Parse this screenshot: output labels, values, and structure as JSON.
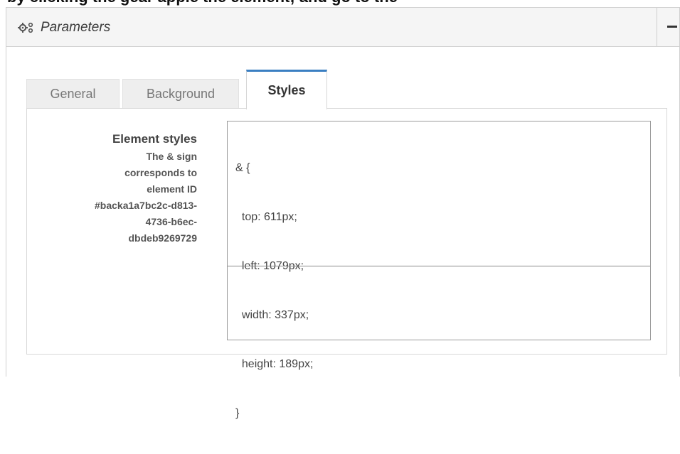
{
  "clipped_header_text": "by clicking the gear  apple  the element; and go to the",
  "panel": {
    "title": "Parameters",
    "collapse_symbol": "−",
    "icon": "gears-icon"
  },
  "tabs": [
    {
      "label": "General",
      "active": false
    },
    {
      "label": "Background",
      "active": false
    },
    {
      "label": "Styles",
      "active": true
    }
  ],
  "styles_field": {
    "label": "Element styles",
    "help_lines": [
      "The & sign",
      "corresponds to",
      "element ID",
      "#backa1a7bc2c-d813-",
      "4736-b6ec-",
      "dbdeb9269729"
    ],
    "code_lines": [
      "& {",
      "  top: 611px;",
      "  left: 1079px;",
      "  width: 337px;",
      "  height: 189px;",
      "}"
    ]
  },
  "colors": {
    "active_tab_accent": "#3a7fc2",
    "header_bg": "#f5f5f5",
    "inactive_tab_bg": "#eeeeee"
  }
}
